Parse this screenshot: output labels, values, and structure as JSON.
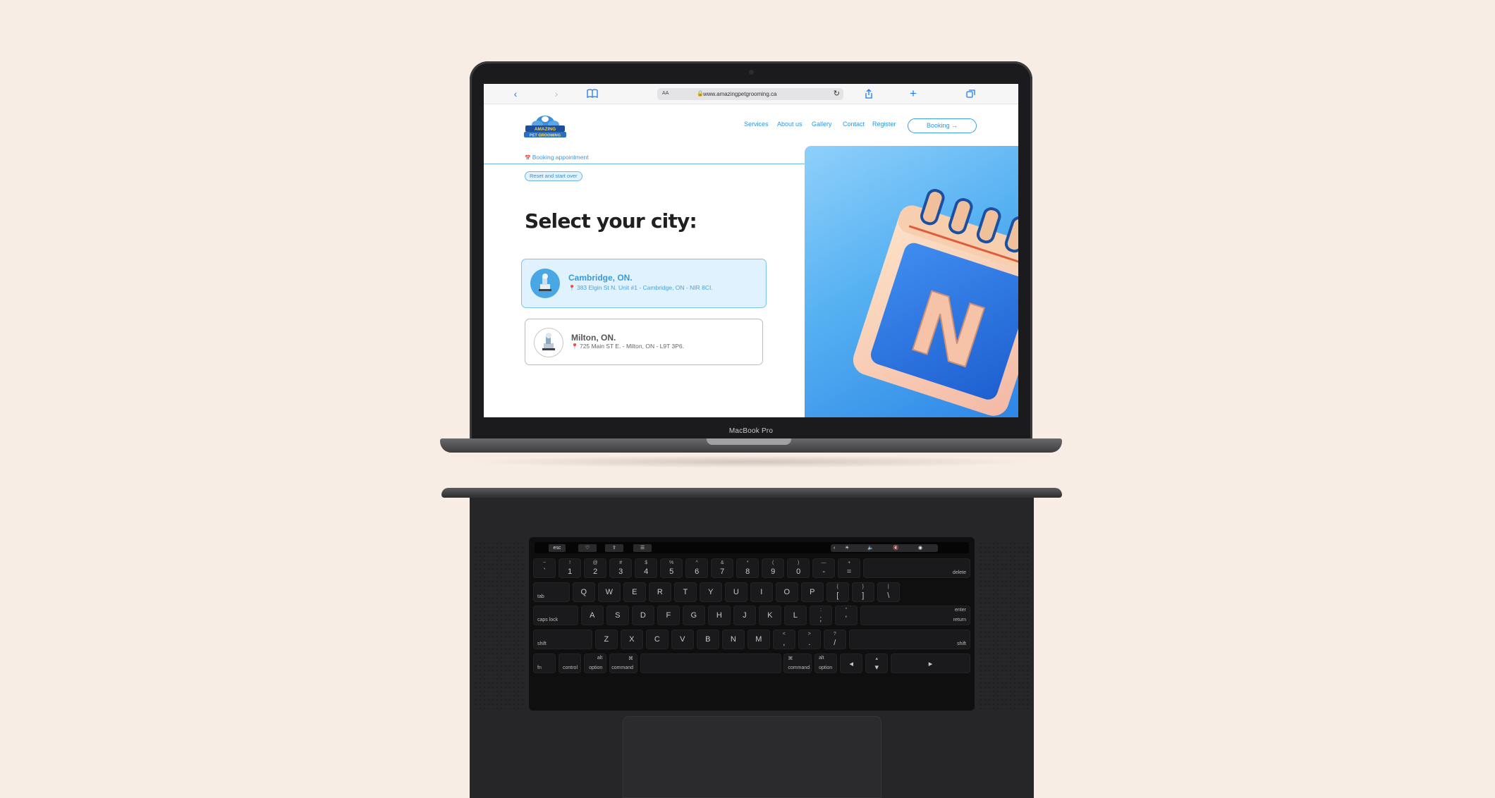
{
  "browser": {
    "url": "www.amazingpetgrooming.ca",
    "reader_label": "AA"
  },
  "brand": {
    "logo_text_line1": "AMAZING",
    "logo_text_line2": "PET GROOMING"
  },
  "nav": {
    "items": [
      "Services",
      "About us",
      "Gallery",
      "Contact",
      "Register"
    ],
    "booking_label": "Booking →"
  },
  "breadcrumb": "Booking appointment",
  "reset_label": "Reset and start over",
  "page_title": "Select your city:",
  "cities": [
    {
      "name": "Cambridge, ON.",
      "address": "383 Elgin St N. Unit #1 - Cambridge, ON - NIR 8CI.",
      "selected": true
    },
    {
      "name": "Milton, ON.",
      "address": "725 Main ST E. - Milton, ON - L9T 3P6.",
      "selected": false
    }
  ],
  "hero": {
    "letter": "N"
  },
  "device_label": "MacBook Pro",
  "colors": {
    "accent": "#2f97dc",
    "background": "#f8ede4",
    "selected_card": "#dff2fd"
  },
  "keyboard": {
    "touchbar_keys": [
      "esc"
    ],
    "row1": [
      [
        "~",
        "`"
      ],
      [
        "!",
        "1"
      ],
      [
        "@",
        "2"
      ],
      [
        "#",
        "3"
      ],
      [
        "$",
        "4"
      ],
      [
        "%",
        "5"
      ],
      [
        "^",
        "6"
      ],
      [
        "&",
        "7"
      ],
      [
        "*",
        "8"
      ],
      [
        "(",
        "9"
      ],
      [
        ")",
        "0"
      ],
      [
        "—",
        "-"
      ],
      [
        "+",
        "="
      ]
    ],
    "delete": "delete",
    "row2": [
      "Q",
      "W",
      "E",
      "R",
      "T",
      "Y",
      "U",
      "I",
      "O",
      "P"
    ],
    "row2_extra": [
      [
        "{",
        "["
      ],
      [
        "}",
        "]"
      ],
      [
        "|",
        "\\"
      ]
    ],
    "tab": "tab",
    "row3": [
      "A",
      "S",
      "D",
      "F",
      "G",
      "H",
      "J",
      "K",
      "L"
    ],
    "row3_extra": [
      [
        ":",
        ";"
      ],
      [
        "\"",
        "'"
      ]
    ],
    "caps": "caps lock",
    "enter": "enter",
    "return": "return",
    "row4": [
      "Z",
      "X",
      "C",
      "V",
      "B",
      "N",
      "M"
    ],
    "row4_extra": [
      [
        "<",
        ","
      ],
      [
        ">",
        "."
      ],
      [
        "?",
        "/"
      ]
    ],
    "shift": "shift",
    "bottom": [
      "fn",
      "control",
      "option",
      "command",
      "command",
      "option"
    ],
    "alt": "alt",
    "cmd_symbol": "⌘"
  }
}
